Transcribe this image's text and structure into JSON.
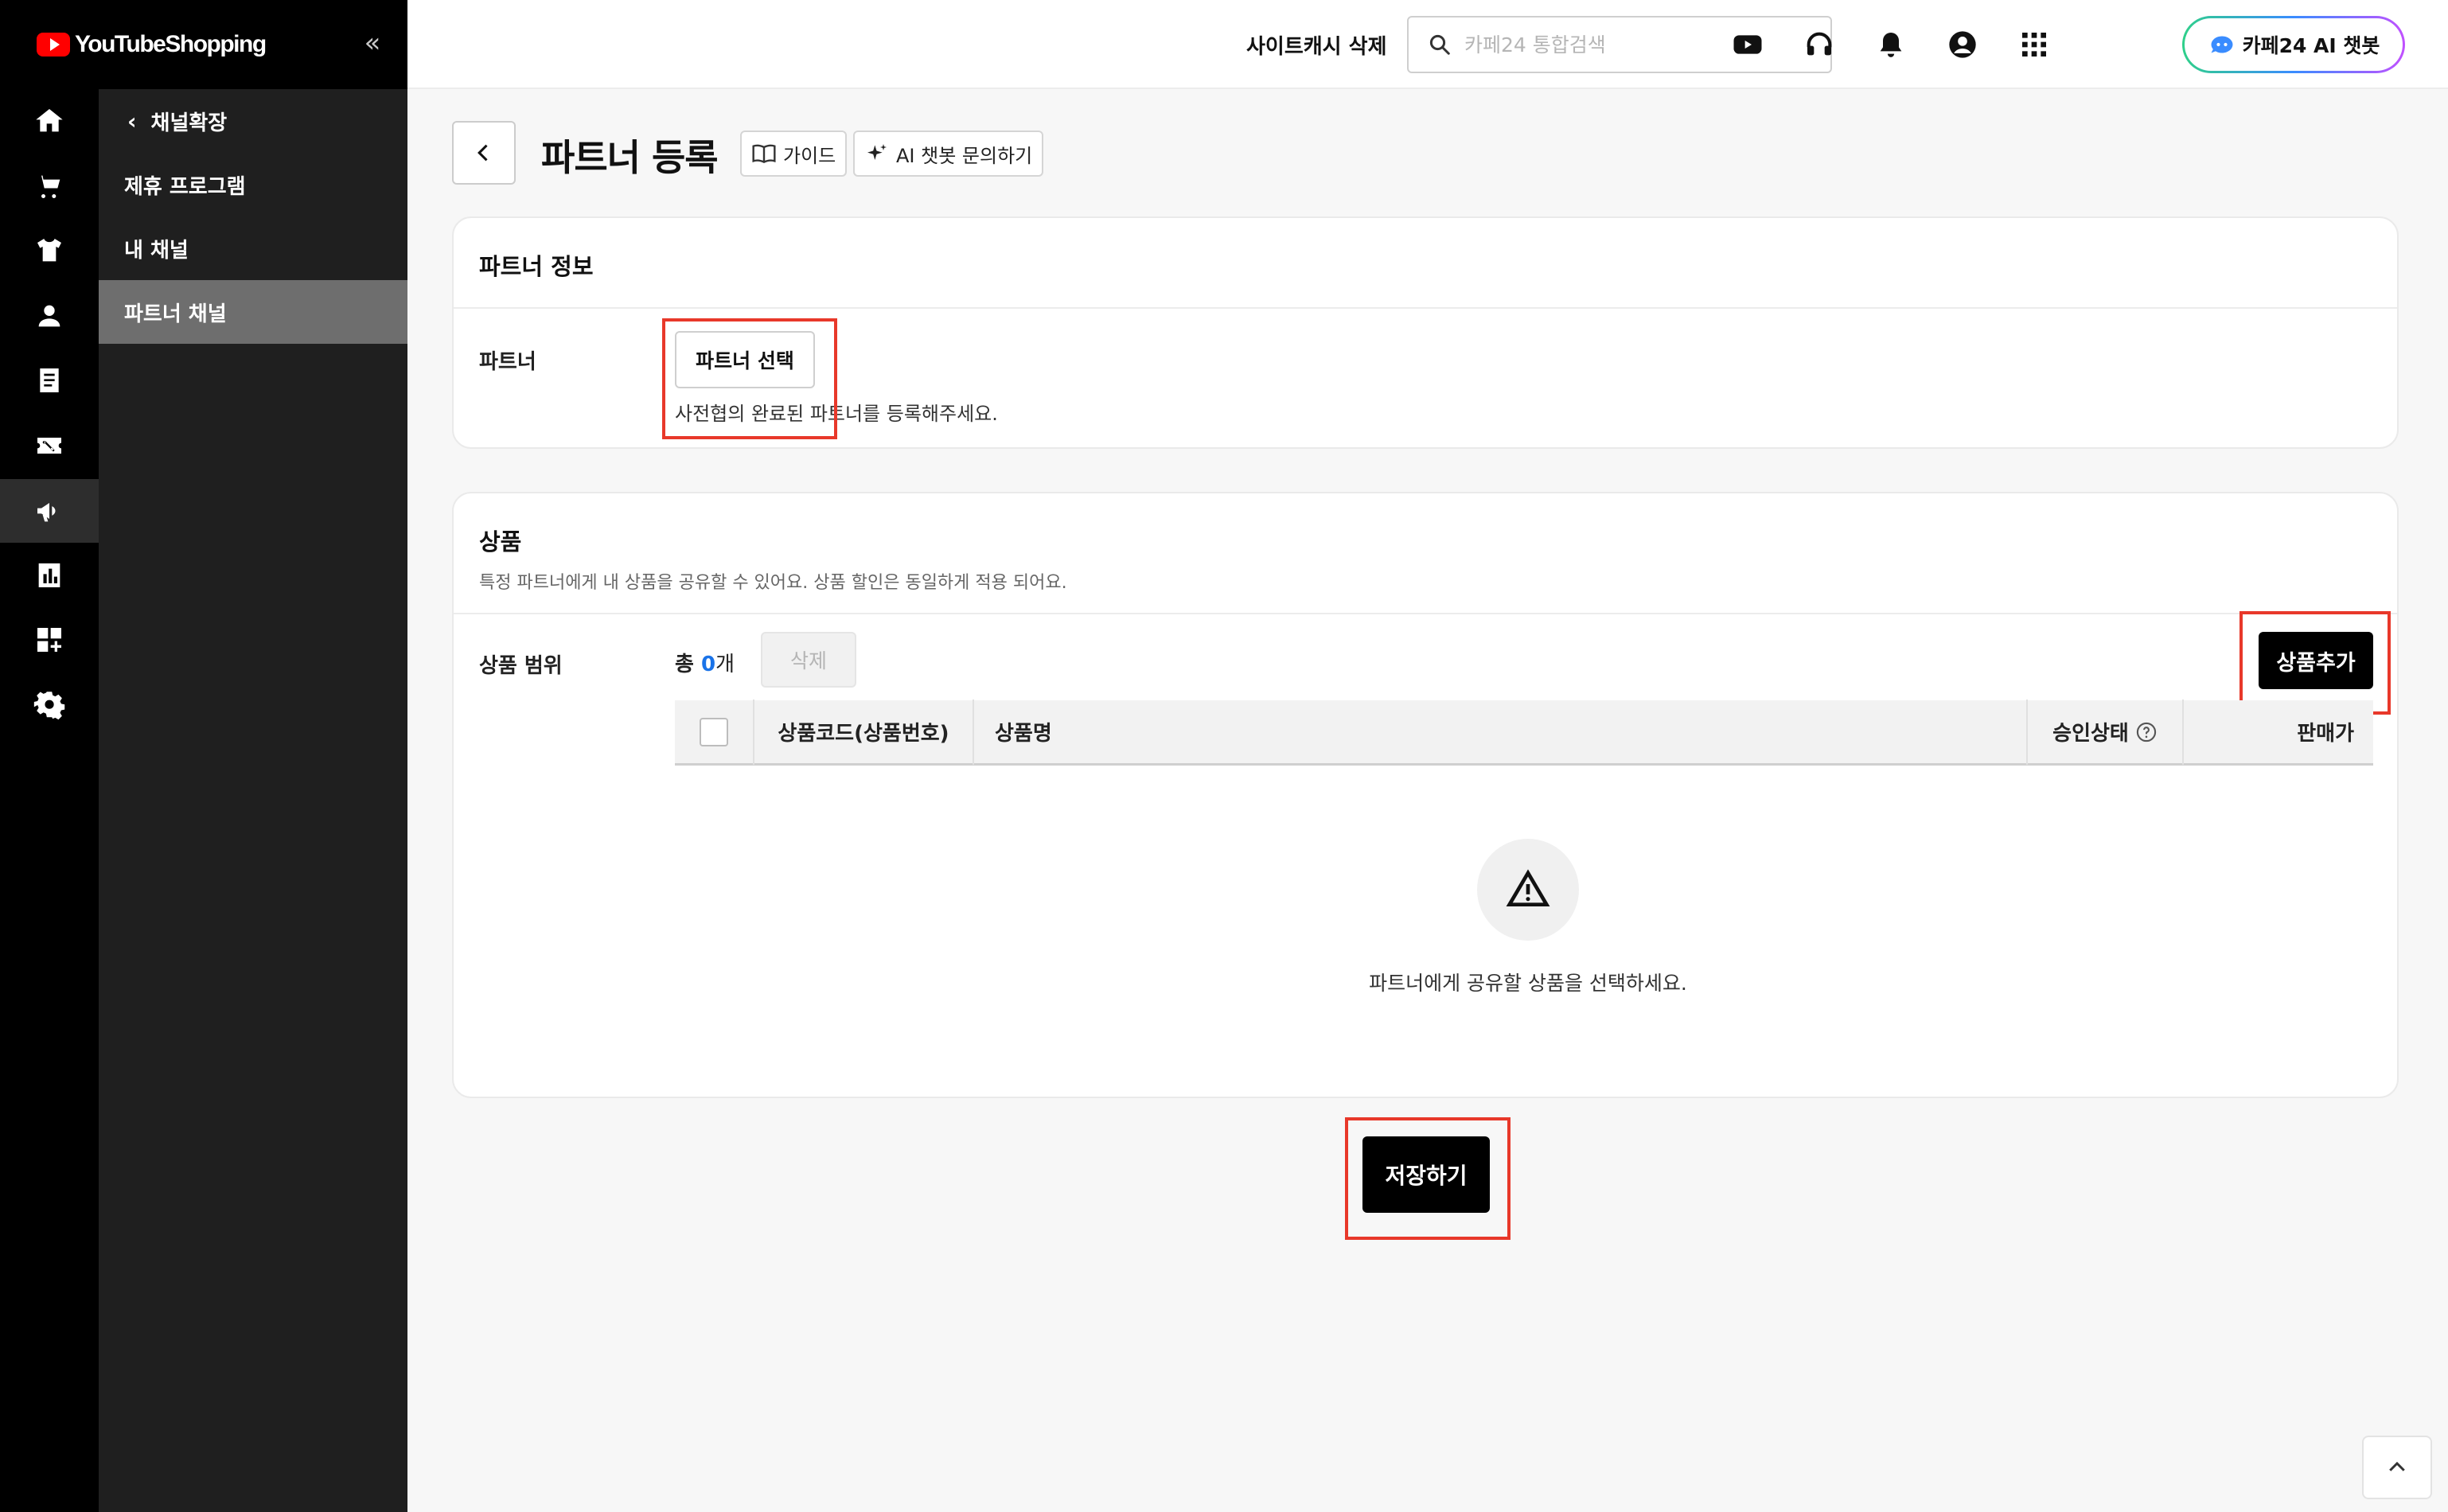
{
  "app": {
    "logo_text": "YouTube Shopping",
    "logo_display": "YouTubeShopping",
    "collapse_label": "«"
  },
  "rail": {
    "icons": [
      "home-icon",
      "cart-icon",
      "shirt-icon",
      "person-icon",
      "document-icon",
      "coupon-icon",
      "megaphone-icon",
      "chart-icon",
      "apps-icon",
      "gear-icon"
    ],
    "active": "megaphone-icon"
  },
  "sidebar": {
    "header": "채널확장",
    "items": [
      {
        "label": "제휴 프로그램",
        "active": false
      },
      {
        "label": "내 채널",
        "active": false
      },
      {
        "label": "파트너 채널",
        "active": true
      }
    ]
  },
  "topbar": {
    "cache_label": "사이트캐시 삭제",
    "search_placeholder": "카페24 통합검색",
    "ai_label": "카페24 AI 챗봇"
  },
  "page": {
    "title": "파트너 등록",
    "guide_label": "가이드",
    "ai_inquiry_label": "AI 챗봇 문의하기"
  },
  "partner_section": {
    "title": "파트너 정보",
    "row_label": "파트너",
    "select_button": "파트너 선택",
    "hint": "사전협의 완료된 파트너를 등록해주세요."
  },
  "product_section": {
    "title": "상품",
    "description": "특정 파트너에게 내 상품을 공유할 수 있어요. 상품 할인은 동일하게 적용 되어요.",
    "row_label": "상품 범위",
    "count_prefix": "총 ",
    "count_value": "0",
    "count_unit": "개",
    "delete_button": "삭제",
    "add_button": "상품추가",
    "columns": [
      "상품코드(상품번호)",
      "상품명",
      "승인상태",
      "판매가"
    ],
    "empty_message": "파트너에게 공유할 상품을 선택하세요."
  },
  "footer": {
    "save_button": "저장하기"
  },
  "colors": {
    "highlight": "#e8382a",
    "count_accent": "#1a73e8",
    "brand_red": "#ff0000"
  }
}
